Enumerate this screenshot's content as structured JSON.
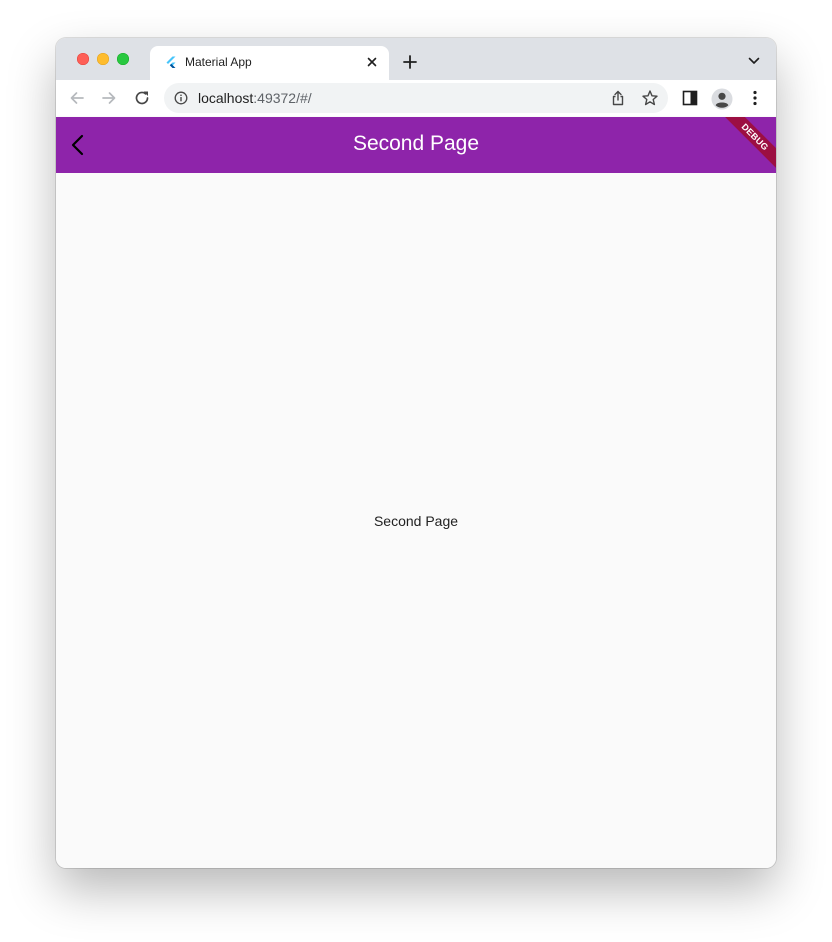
{
  "browser": {
    "tab": {
      "title": "Material App",
      "favicon": "flutter-logo-icon"
    },
    "address_bar": {
      "host": "localhost",
      "path": ":49372/#/"
    },
    "icons": {
      "back": "arrow-left-icon",
      "forward": "arrow-right-icon",
      "reload": "reload-icon",
      "info": "info-icon",
      "share": "share-icon",
      "bookmark": "star-icon",
      "side_panel": "side-panel-icon",
      "profile": "profile-avatar-icon",
      "menu": "kebab-menu-icon",
      "new_tab": "plus-icon",
      "tab_search": "chevron-down-icon",
      "close_tab": "close-icon"
    }
  },
  "app": {
    "app_bar": {
      "title": "Second Page",
      "color": "#8e24aa",
      "back_icon": "chevron-left-icon"
    },
    "debug_banner": "DEBUG",
    "body": {
      "text": "Second Page"
    }
  }
}
